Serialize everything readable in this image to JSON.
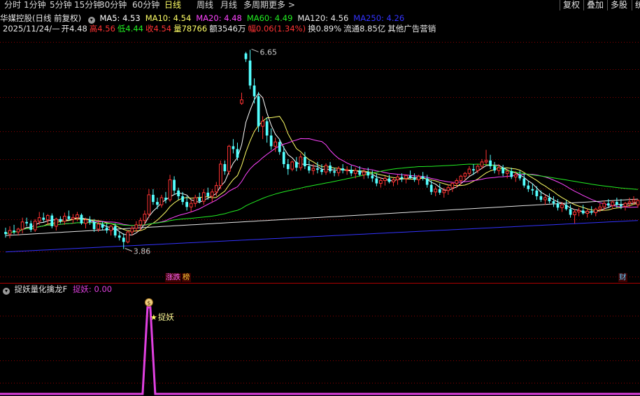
{
  "toolbar": {
    "tabs": [
      "分时",
      "1分钟",
      "5分钟",
      "15分钟",
      "30分钟",
      "60分钟",
      "日线",
      "周线",
      "月线",
      "多周期",
      "更多 >"
    ],
    "active_tab": "日线",
    "right_buttons": [
      "复权",
      "叠加",
      "多股",
      "统"
    ]
  },
  "header": {
    "title": "华媒控股(日线 前复权)",
    "ma": [
      {
        "label": "MA5: 4.53",
        "color": "#ffffff"
      },
      {
        "label": "MA10: 4.54",
        "color": "#ffff66"
      },
      {
        "label": "MA20: 4.48",
        "color": "#ff44ff"
      },
      {
        "label": "MA60: 4.49",
        "color": "#22ee22"
      },
      {
        "label": "MA120: 4.56",
        "color": "#e8e8e8"
      },
      {
        "label": "MA250: 4.26",
        "color": "#3333ff"
      }
    ],
    "info": [
      {
        "text": "2025/11/24/—",
        "color": "#e8e8e8"
      },
      {
        "text": "开4.48",
        "color": "#e8e8e8"
      },
      {
        "text": "高4.56",
        "color": "#ff3333"
      },
      {
        "text": "低4.44",
        "color": "#22ee22"
      },
      {
        "text": "收4.54",
        "color": "#ff3333"
      },
      {
        "text": "量78766",
        "color": "#ffff66"
      },
      {
        "text": "额3546万",
        "color": "#e8e8e8"
      },
      {
        "text": "幅0.06(1.34%)",
        "color": "#ff3333"
      },
      {
        "text": "换0.89%",
        "color": "#e8e8e8"
      },
      {
        "text": "流通8.85亿",
        "color": "#e8e8e8"
      },
      {
        "text": "其他广告营销",
        "color": "#e8e8e8"
      }
    ]
  },
  "badges": [
    {
      "text": "涨跌",
      "color": "#ff66ff"
    },
    {
      "text": "榜",
      "color": "#ffcc33"
    },
    {
      "text": "财",
      "color": "#66ccff"
    }
  ],
  "indicator": {
    "name": "捉妖量化擒龙F",
    "value_label": "捉妖: 0.00",
    "signal_text": "捉妖",
    "signal_icon": "$",
    "signal_index": 34
  },
  "colors": {
    "up": "#ff3333",
    "down": "#54ffff",
    "ma5": "#ffffff",
    "ma10": "#ffff66",
    "ma20": "#ff44ff",
    "ma60": "#22ee22",
    "ma120": "#e8e8e8",
    "ma250": "#3333ff",
    "indicator": "#e040e0",
    "grid": "#8b0000",
    "bg": "#000000"
  },
  "chart_data": {
    "type": "candlestick",
    "ylim": [
      3.7,
      6.8
    ],
    "annotations": [
      {
        "text": "6.65",
        "index": 58,
        "value": 6.65
      },
      {
        "text": "3.86",
        "index": 28,
        "value": 3.86
      }
    ],
    "series": [
      {
        "name": "OHLC",
        "values": [
          [
            4.1,
            4.16,
            4.02,
            4.07
          ],
          [
            4.07,
            4.18,
            4.01,
            4.12
          ],
          [
            4.12,
            4.2,
            4.07,
            4.1
          ],
          [
            4.1,
            4.16,
            4.05,
            4.14
          ],
          [
            4.14,
            4.3,
            4.08,
            4.24
          ],
          [
            4.24,
            4.3,
            4.18,
            4.22
          ],
          [
            4.22,
            4.26,
            4.1,
            4.13
          ],
          [
            4.13,
            4.28,
            4.1,
            4.25
          ],
          [
            4.25,
            4.38,
            4.2,
            4.3
          ],
          [
            4.3,
            4.37,
            4.24,
            4.27
          ],
          [
            4.27,
            4.35,
            4.2,
            4.33
          ],
          [
            4.33,
            4.36,
            4.15,
            4.18
          ],
          [
            4.18,
            4.3,
            4.12,
            4.28
          ],
          [
            4.28,
            4.32,
            4.22,
            4.25
          ],
          [
            4.25,
            4.37,
            4.2,
            4.32
          ],
          [
            4.32,
            4.4,
            4.26,
            4.28
          ],
          [
            4.28,
            4.35,
            4.22,
            4.3
          ],
          [
            4.3,
            4.38,
            4.25,
            4.34
          ],
          [
            4.34,
            4.36,
            4.2,
            4.22
          ],
          [
            4.22,
            4.3,
            4.15,
            4.27
          ],
          [
            4.27,
            4.32,
            4.2,
            4.24
          ],
          [
            4.24,
            4.28,
            4.1,
            4.14
          ],
          [
            4.14,
            4.25,
            4.1,
            4.21
          ],
          [
            4.21,
            4.25,
            4.12,
            4.16
          ],
          [
            4.16,
            4.22,
            4.08,
            4.12
          ],
          [
            4.12,
            4.2,
            4.05,
            4.18
          ],
          [
            4.18,
            4.22,
            4.02,
            4.05
          ],
          [
            4.05,
            4.1,
            3.98,
            4.02
          ],
          [
            4.02,
            4.08,
            3.86,
            3.96
          ],
          [
            3.96,
            4.12,
            3.94,
            4.1
          ],
          [
            4.1,
            4.18,
            4.05,
            4.15
          ],
          [
            4.15,
            4.25,
            4.1,
            4.2
          ],
          [
            4.2,
            4.3,
            4.12,
            4.26
          ],
          [
            4.26,
            4.4,
            4.2,
            4.35
          ],
          [
            4.35,
            4.7,
            4.3,
            4.62
          ],
          [
            4.62,
            4.7,
            4.48,
            4.52
          ],
          [
            4.52,
            4.58,
            4.42,
            4.48
          ],
          [
            4.48,
            4.62,
            4.44,
            4.58
          ],
          [
            4.58,
            4.66,
            4.5,
            4.55
          ],
          [
            4.55,
            4.9,
            4.52,
            4.83
          ],
          [
            4.83,
            4.88,
            4.62,
            4.68
          ],
          [
            4.68,
            4.72,
            4.55,
            4.6
          ],
          [
            4.6,
            4.66,
            4.48,
            4.52
          ],
          [
            4.52,
            4.6,
            4.4,
            4.45
          ],
          [
            4.45,
            4.55,
            4.38,
            4.5
          ],
          [
            4.5,
            4.62,
            4.45,
            4.58
          ],
          [
            4.58,
            4.65,
            4.5,
            4.53
          ],
          [
            4.53,
            4.7,
            4.48,
            4.65
          ],
          [
            4.65,
            4.72,
            4.55,
            4.6
          ],
          [
            4.6,
            4.7,
            4.52,
            4.66
          ],
          [
            4.66,
            4.8,
            4.6,
            4.75
          ],
          [
            4.75,
            5.1,
            4.7,
            5.05
          ],
          [
            5.05,
            5.1,
            4.9,
            4.95
          ],
          [
            4.95,
            5.32,
            4.9,
            5.3
          ],
          [
            5.3,
            5.4,
            5.2,
            5.26
          ],
          [
            5.26,
            5.35,
            5.1,
            5.14
          ],
          [
            5.9,
            6.05,
            5.88,
            5.95
          ],
          [
            6.6,
            6.62,
            6.48,
            6.52
          ],
          [
            6.5,
            6.65,
            6.1,
            6.15
          ],
          [
            6.15,
            6.25,
            5.9,
            6.0
          ],
          [
            6.0,
            6.06,
            5.5,
            5.58
          ],
          [
            5.58,
            5.72,
            5.4,
            5.65
          ],
          [
            5.65,
            5.7,
            5.35,
            5.45
          ],
          [
            5.45,
            5.55,
            5.25,
            5.3
          ],
          [
            5.3,
            5.42,
            5.22,
            5.36
          ],
          [
            5.36,
            5.4,
            5.18,
            5.22
          ],
          [
            5.22,
            5.3,
            5.0,
            5.05
          ],
          [
            5.05,
            5.12,
            4.9,
            4.98
          ],
          [
            4.98,
            5.1,
            4.95,
            5.08
          ],
          [
            5.08,
            5.15,
            4.95,
            5.0
          ],
          [
            5.0,
            5.2,
            4.96,
            5.15
          ],
          [
            5.15,
            5.22,
            4.98,
            5.02
          ],
          [
            5.02,
            5.1,
            4.92,
            4.96
          ],
          [
            4.96,
            5.05,
            4.9,
            4.99
          ],
          [
            4.99,
            5.08,
            4.92,
            4.97
          ],
          [
            4.97,
            5.05,
            4.9,
            4.94
          ],
          [
            4.94,
            5.06,
            4.9,
            5.03
          ],
          [
            5.03,
            5.08,
            4.92,
            4.95
          ],
          [
            4.95,
            5.0,
            4.88,
            4.93
          ],
          [
            4.93,
            5.02,
            4.88,
            4.99
          ],
          [
            4.99,
            5.05,
            4.92,
            4.96
          ],
          [
            4.96,
            5.02,
            4.9,
            4.97
          ],
          [
            4.97,
            5.03,
            4.88,
            4.92
          ],
          [
            4.92,
            5.0,
            4.85,
            4.96
          ],
          [
            4.96,
            5.02,
            4.88,
            4.9
          ],
          [
            4.9,
            4.98,
            4.84,
            4.94
          ],
          [
            4.94,
            5.0,
            4.85,
            4.89
          ],
          [
            4.89,
            4.96,
            4.8,
            4.85
          ],
          [
            4.85,
            4.92,
            4.74,
            4.78
          ],
          [
            4.78,
            4.86,
            4.72,
            4.82
          ],
          [
            4.82,
            4.88,
            4.75,
            4.85
          ],
          [
            4.85,
            4.9,
            4.78,
            4.8
          ],
          [
            4.8,
            4.86,
            4.74,
            4.83
          ],
          [
            4.83,
            4.9,
            4.76,
            4.87
          ],
          [
            4.87,
            4.92,
            4.8,
            4.85
          ],
          [
            4.85,
            4.9,
            4.78,
            4.89
          ],
          [
            4.89,
            4.96,
            4.84,
            4.86
          ],
          [
            4.86,
            4.92,
            4.8,
            4.83
          ],
          [
            4.83,
            4.9,
            4.76,
            4.88
          ],
          [
            4.88,
            4.94,
            4.82,
            4.85
          ],
          [
            4.85,
            4.9,
            4.72,
            4.76
          ],
          [
            4.76,
            4.82,
            4.62,
            4.66
          ],
          [
            4.66,
            4.74,
            4.6,
            4.7
          ],
          [
            4.7,
            4.78,
            4.62,
            4.65
          ],
          [
            4.65,
            4.72,
            4.58,
            4.68
          ],
          [
            4.68,
            4.76,
            4.62,
            4.72
          ],
          [
            4.72,
            4.8,
            4.66,
            4.78
          ],
          [
            4.78,
            4.85,
            4.72,
            4.82
          ],
          [
            4.82,
            4.9,
            4.76,
            4.88
          ],
          [
            4.88,
            4.94,
            4.82,
            4.92
          ],
          [
            4.92,
            5.02,
            4.88,
            4.98
          ],
          [
            4.98,
            5.05,
            4.9,
            4.96
          ],
          [
            4.96,
            5.05,
            4.92,
            5.02
          ],
          [
            5.02,
            5.12,
            4.98,
            5.08
          ],
          [
            5.08,
            5.25,
            5.04,
            5.1
          ],
          [
            5.1,
            5.18,
            4.98,
            5.02
          ],
          [
            5.02,
            5.08,
            4.92,
            4.96
          ],
          [
            4.96,
            5.05,
            4.9,
            5.0
          ],
          [
            5.0,
            5.04,
            4.88,
            4.92
          ],
          [
            4.92,
            4.98,
            4.85,
            4.95
          ],
          [
            4.95,
            5.0,
            4.84,
            4.87
          ],
          [
            4.87,
            4.95,
            4.8,
            4.9
          ],
          [
            4.9,
            4.96,
            4.82,
            4.85
          ],
          [
            4.85,
            4.92,
            4.72,
            4.75
          ],
          [
            4.75,
            4.82,
            4.66,
            4.7
          ],
          [
            4.7,
            4.78,
            4.62,
            4.68
          ],
          [
            4.68,
            4.74,
            4.55,
            4.6
          ],
          [
            4.6,
            4.68,
            4.52,
            4.55
          ],
          [
            4.55,
            4.62,
            4.48,
            4.58
          ],
          [
            4.58,
            4.64,
            4.5,
            4.53
          ],
          [
            4.53,
            4.6,
            4.45,
            4.5
          ],
          [
            4.5,
            4.56,
            4.4,
            4.44
          ],
          [
            4.44,
            4.52,
            4.38,
            4.48
          ],
          [
            4.48,
            4.54,
            4.4,
            4.42
          ],
          [
            4.42,
            4.48,
            4.3,
            4.34
          ],
          [
            4.34,
            4.42,
            4.22,
            4.38
          ],
          [
            4.38,
            4.44,
            4.32,
            4.4
          ],
          [
            4.4,
            4.48,
            4.34,
            4.36
          ],
          [
            4.36,
            4.42,
            4.3,
            4.39
          ],
          [
            4.39,
            4.46,
            4.34,
            4.37
          ],
          [
            4.37,
            4.44,
            4.32,
            4.42
          ],
          [
            4.42,
            4.5,
            4.38,
            4.45
          ],
          [
            4.45,
            4.54,
            4.4,
            4.5
          ],
          [
            4.5,
            4.56,
            4.44,
            4.47
          ],
          [
            4.47,
            4.54,
            4.42,
            4.52
          ],
          [
            4.52,
            4.58,
            4.44,
            4.48
          ],
          [
            4.48,
            4.56,
            4.42,
            4.46
          ],
          [
            4.46,
            4.52,
            4.4,
            4.5
          ],
          [
            4.5,
            4.58,
            4.44,
            4.52
          ],
          [
            4.52,
            4.6,
            4.48,
            4.55
          ],
          [
            4.48,
            4.56,
            4.44,
            4.54
          ]
        ]
      }
    ]
  }
}
